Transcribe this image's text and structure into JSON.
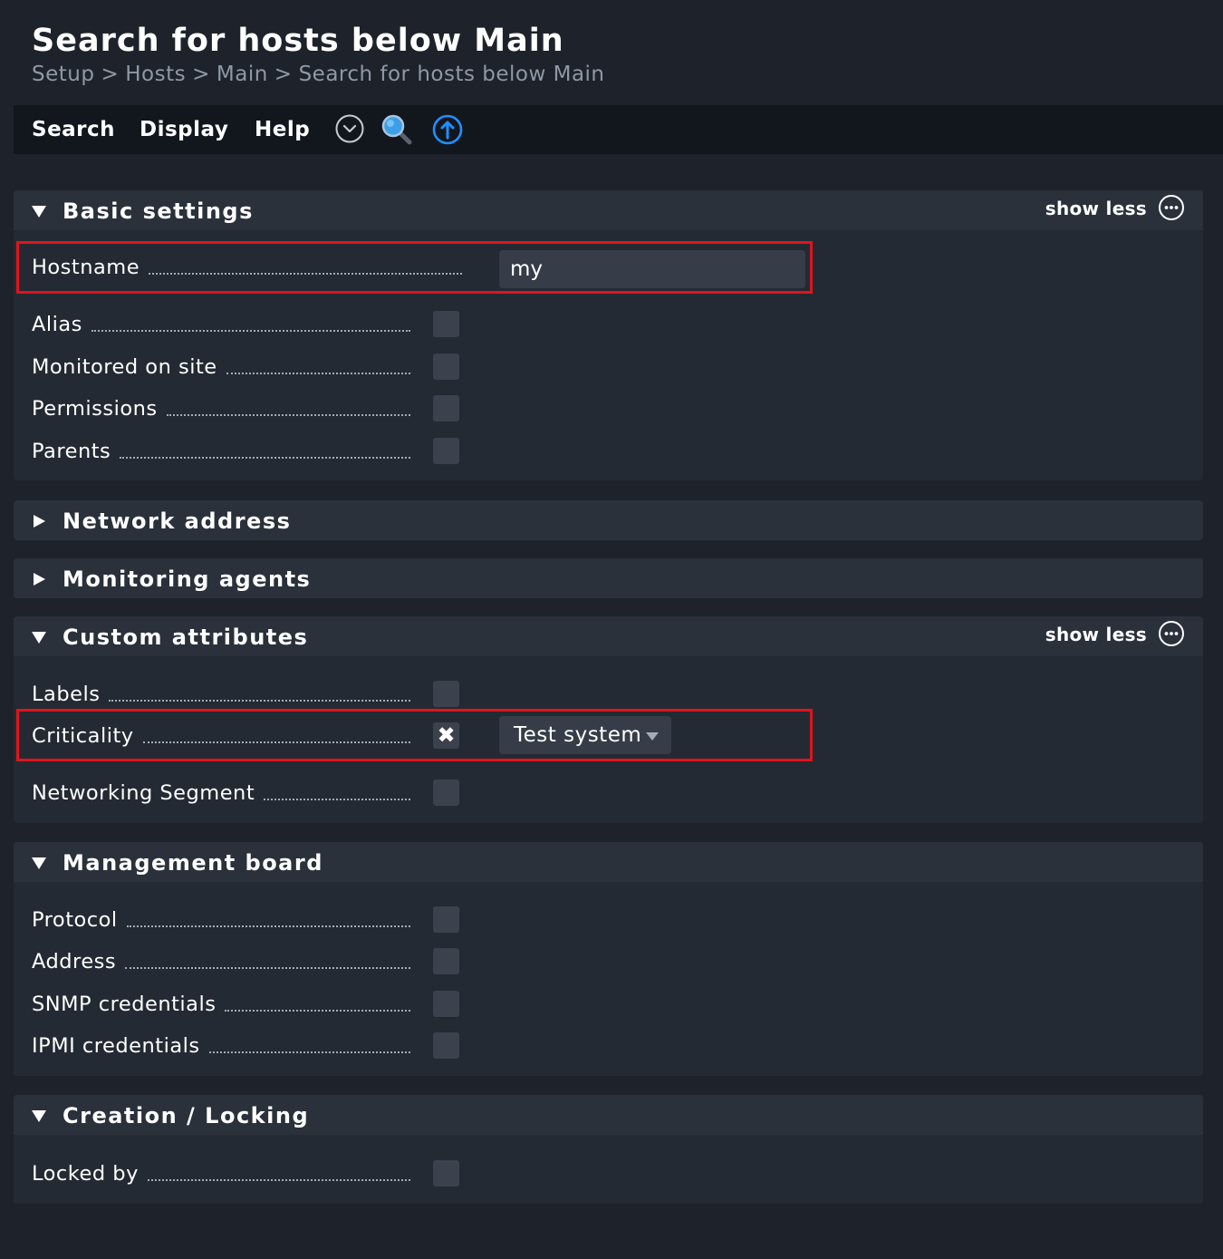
{
  "header": {
    "title": "Search for hosts below Main",
    "breadcrumb": [
      "Setup",
      "Hosts",
      "Main",
      "Search for hosts below Main"
    ],
    "breadcrumb_sep": ">"
  },
  "menubar": {
    "items": [
      "Search",
      "Display",
      "Help"
    ],
    "icons": [
      "chevron-circle-down-icon",
      "search-magnifier-icon",
      "upload-arrow-icon"
    ],
    "accent_color": "#1e90ff"
  },
  "sections": {
    "basic": {
      "title": "Basic settings",
      "show_less": "show less",
      "rows": {
        "hostname": {
          "label": "Hostname",
          "value": "my"
        },
        "alias": {
          "label": "Alias"
        },
        "site": {
          "label": "Monitored on site"
        },
        "permissions": {
          "label": "Permissions"
        },
        "parents": {
          "label": "Parents"
        }
      }
    },
    "network": {
      "title": "Network address"
    },
    "agents": {
      "title": "Monitoring agents"
    },
    "custom": {
      "title": "Custom attributes",
      "show_less": "show less",
      "rows": {
        "labels": {
          "label": "Labels"
        },
        "criticality": {
          "label": "Criticality",
          "checked_mark": "✖",
          "value": "Test system"
        },
        "networking": {
          "label": "Networking Segment"
        }
      }
    },
    "management": {
      "title": "Management board",
      "rows": {
        "protocol": {
          "label": "Protocol"
        },
        "address": {
          "label": "Address"
        },
        "snmp": {
          "label": "SNMP credentials"
        },
        "ipmi": {
          "label": "IPMI credentials"
        }
      }
    },
    "creation": {
      "title": "Creation / Locking",
      "rows": {
        "locked_by": {
          "label": "Locked by"
        }
      }
    }
  },
  "colors": {
    "background": "#1e232b",
    "section_body": "#242a33",
    "section_header": "#2b313b",
    "highlight": "#e0141c"
  }
}
